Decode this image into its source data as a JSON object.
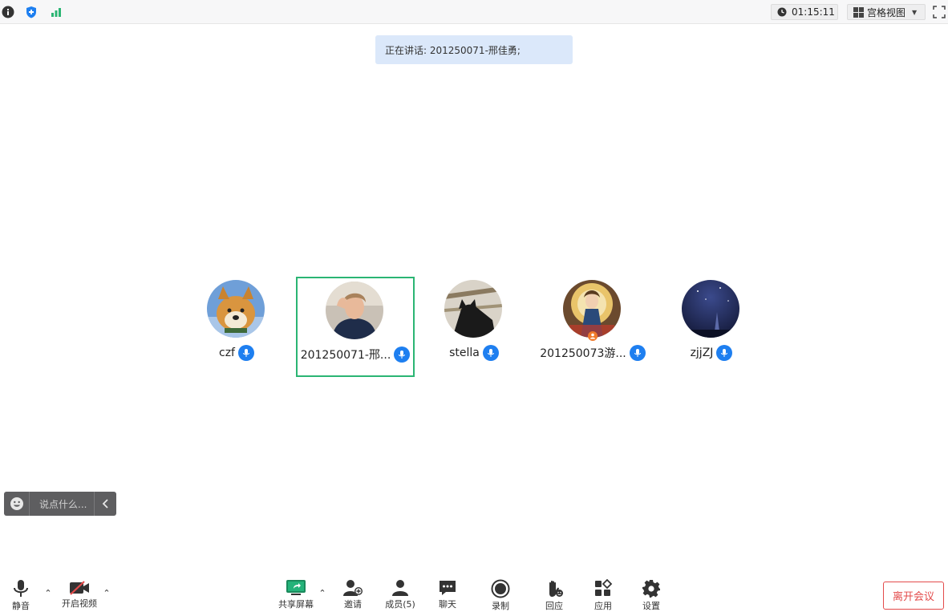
{
  "topbar": {
    "timer": "01:15:11",
    "view_mode": "宫格视图"
  },
  "speaking_banner": "正在讲话: 201250071-邢佳勇;",
  "participants": [
    {
      "name": "czf",
      "active": false
    },
    {
      "name": "201250071-邢...",
      "active": true
    },
    {
      "name": "stella",
      "active": false
    },
    {
      "name": "201250073游...",
      "active": false,
      "host": true
    },
    {
      "name": "zjjZJ",
      "active": false
    }
  ],
  "chat": {
    "placeholder": "说点什么..."
  },
  "toolbar": {
    "mute": "静音",
    "video": "开启视频",
    "share": "共享屏幕",
    "invite": "邀请",
    "members": "成员(5)",
    "chat": "聊天",
    "record": "录制",
    "react": "回应",
    "apps": "应用",
    "settings": "设置",
    "leave": "离开会议"
  },
  "colors": {
    "accent": "#1e7ff0",
    "active_border": "#2bb573",
    "leave": "#e34b4b",
    "banner_bg": "#dbe8fa"
  }
}
